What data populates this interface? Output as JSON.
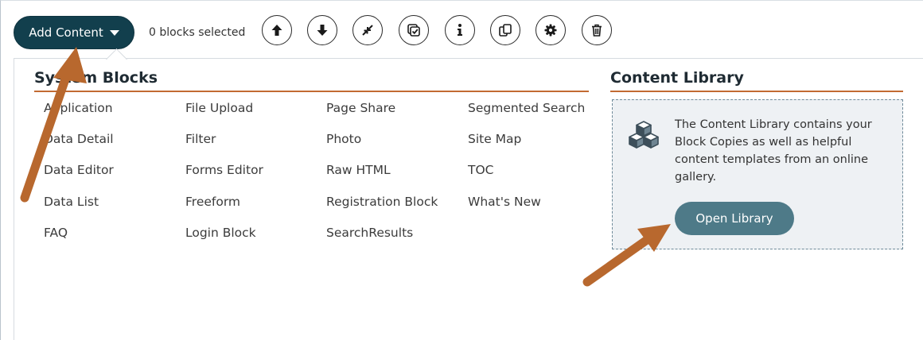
{
  "toolbar": {
    "add_content_label": "Add Content",
    "selection_status": "0 blocks selected",
    "tools": [
      {
        "name": "move-up",
        "icon": "arrow-up-icon"
      },
      {
        "name": "move-down",
        "icon": "arrow-down-icon"
      },
      {
        "name": "resize",
        "icon": "resize-icon"
      },
      {
        "name": "block-copy",
        "icon": "checkbox-copy-icon"
      },
      {
        "name": "info",
        "icon": "info-icon"
      },
      {
        "name": "duplicate",
        "icon": "copy-icon"
      },
      {
        "name": "settings",
        "icon": "gear-icon"
      },
      {
        "name": "delete",
        "icon": "trash-icon"
      }
    ]
  },
  "system_blocks": {
    "title": "System Blocks",
    "columns": [
      [
        "Application",
        "Data Detail",
        "Data Editor",
        "Data List",
        "FAQ"
      ],
      [
        "File Upload",
        "Filter",
        "Forms Editor",
        "Freeform",
        "Login Block"
      ],
      [
        "Page Share",
        "Photo",
        "Raw HTML",
        "Registration Block",
        "SearchResults"
      ],
      [
        "Segmented Search",
        "Site Map",
        "TOC",
        "What's New"
      ]
    ]
  },
  "content_library": {
    "title": "Content Library",
    "description": "The Content Library contains your Block Copies as well as helpful content templates from an online gallery.",
    "button_label": "Open Library",
    "icon": "cubes-icon"
  },
  "colors": {
    "primary_dark": "#123f4d",
    "button_teal": "#4e7a88",
    "accent_rule": "#c26a32",
    "annotation_arrow": "#b8682e",
    "library_bg": "#eef1f4"
  }
}
